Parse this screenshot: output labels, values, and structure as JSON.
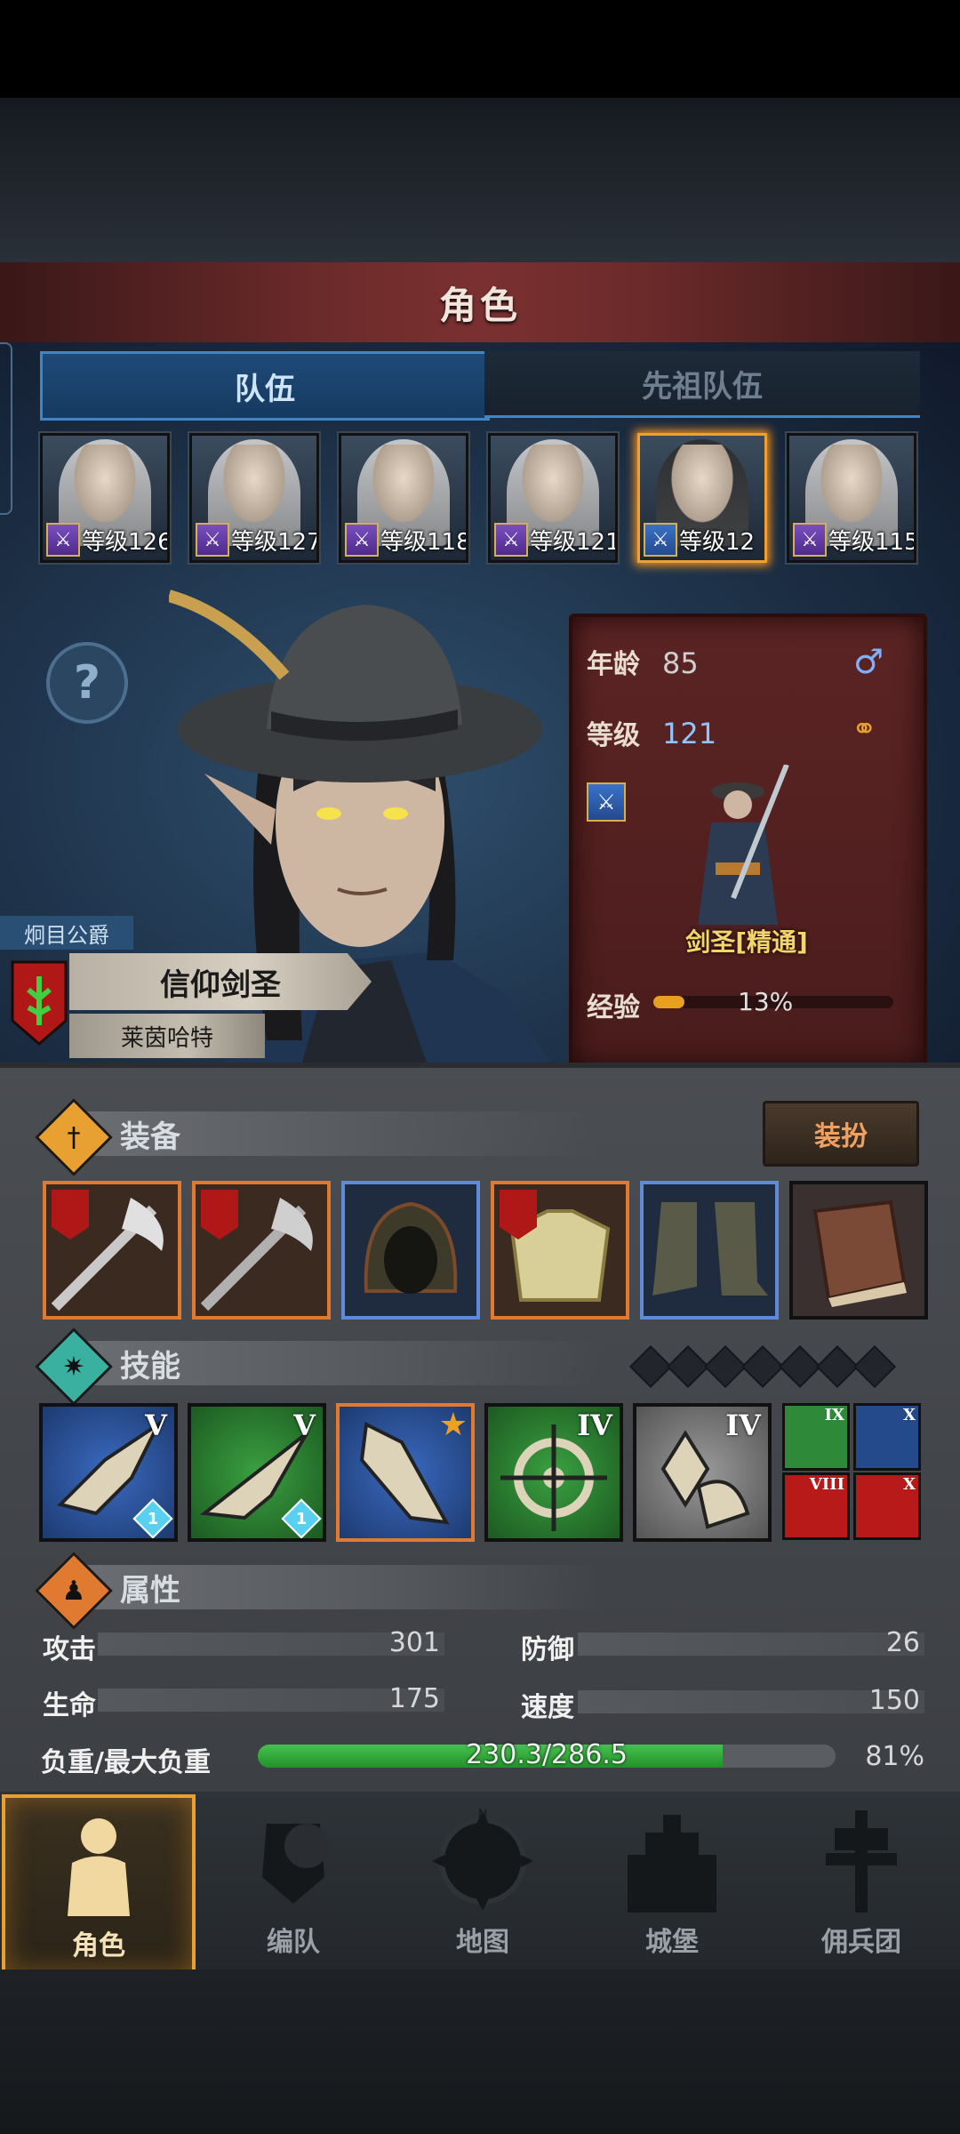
{
  "header": {
    "title": "角色"
  },
  "tabs": {
    "team": "队伍",
    "ancestors": "先祖队伍"
  },
  "portraits": [
    {
      "level": "等级126",
      "class_color": "purple"
    },
    {
      "level": "等级127",
      "class_color": "purple"
    },
    {
      "level": "等级118",
      "class_color": "purple"
    },
    {
      "level": "等级121",
      "class_color": "purple"
    },
    {
      "level": "等级12",
      "class_color": "blue"
    },
    {
      "level": "等级115",
      "class_color": "purple"
    }
  ],
  "character": {
    "rank": "炯目公爵",
    "title": "信仰剑圣",
    "name": "莱茵哈特"
  },
  "stats_card": {
    "age_label": "年龄",
    "age": "85",
    "level_label": "等级",
    "level": "121",
    "class_name": "剑圣[精通]",
    "exp_label": "经验",
    "exp_percent": "13%",
    "exp_fraction": 0.13
  },
  "equipment": {
    "header": "装备",
    "dress_button": "装扮",
    "slots": [
      "halberd",
      "halberd",
      "hood",
      "armor",
      "boots",
      "book"
    ]
  },
  "skills": {
    "header": "技能",
    "main": [
      {
        "tier": "V",
        "gem": "1",
        "color": "blue"
      },
      {
        "tier": "V",
        "gem": "1",
        "color": "green"
      },
      {
        "tier": "",
        "star": "★",
        "color": "blue"
      },
      {
        "tier": "IV",
        "color": "green"
      },
      {
        "tier": "IV",
        "color": "gray"
      }
    ],
    "mini": [
      {
        "tier": "IX",
        "color": "green"
      },
      {
        "tier": "X",
        "color": "blue"
      },
      {
        "tier": "VIII",
        "color": "red"
      },
      {
        "tier": "X",
        "color": "red"
      }
    ]
  },
  "attributes": {
    "header": "属性",
    "attack_label": "攻击",
    "attack": "301",
    "defense_label": "防御",
    "defense": "26",
    "hp_label": "生命",
    "hp": "175",
    "speed_label": "速度",
    "speed": "150",
    "load_label": "负重/最大负重",
    "load": "230.3/286.5",
    "load_percent": "81%"
  },
  "nav": {
    "character": "角色",
    "formation": "编队",
    "map": "地图",
    "castle": "城堡",
    "mercenary": "佣兵团",
    "map_compass_n": "N"
  },
  "colors": {
    "accent_orange": "#e8a030",
    "tab_blue": "#3f86c8",
    "title_red": "#7a3030",
    "load_green": "#2ea838"
  }
}
